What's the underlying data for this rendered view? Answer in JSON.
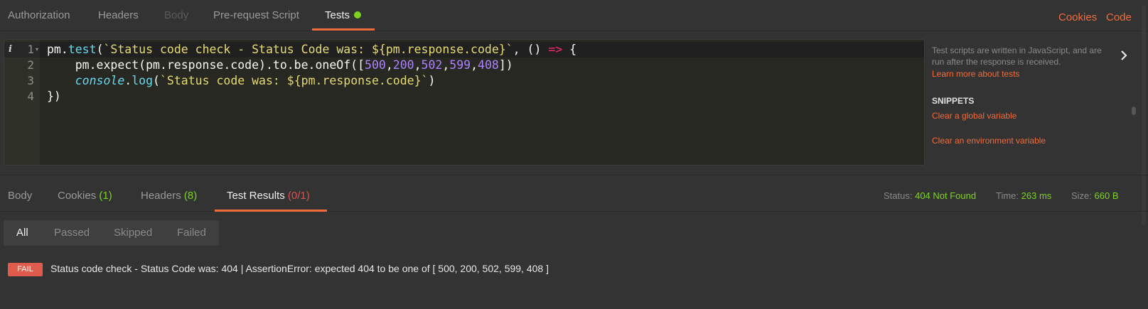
{
  "request_tabs": {
    "authorization": "Authorization",
    "headers": "Headers",
    "body": "Body",
    "pre_request": "Pre-request Script",
    "tests": "Tests"
  },
  "top_links": {
    "cookies": "Cookies",
    "code": "Code"
  },
  "editor": {
    "line_numbers": [
      "1",
      "2",
      "3",
      "4"
    ],
    "info_glyph": "i"
  },
  "side_panel": {
    "description": "Test scripts are written in JavaScript, and are run after the response is received.",
    "learn_more": "Learn more about tests",
    "snippets_heading": "SNIPPETS",
    "snippets": [
      "Clear a global variable",
      "Clear an environment variable"
    ]
  },
  "response_tabs": {
    "body": "Body",
    "cookies": "Cookies",
    "cookies_count": "(1)",
    "headers": "Headers",
    "headers_count": "(8)",
    "test_results": "Test Results",
    "test_results_count": "(0/1)"
  },
  "status_bar": {
    "status_label": "Status:",
    "status_value": "404 Not Found",
    "time_label": "Time:",
    "time_value": "263 ms",
    "size_label": "Size:",
    "size_value": "660 B"
  },
  "filters": [
    "All",
    "Passed",
    "Skipped",
    "Failed"
  ],
  "result": {
    "badge": "FAIL",
    "message": "Status code check - Status Code was: 404 | AssertionError: expected 404 to be one of [ 500, 200, 502, 599, 408 ]"
  },
  "colors": {
    "accent": "#f26b3a",
    "success": "#7ed321",
    "fail": "#e05b4c"
  }
}
